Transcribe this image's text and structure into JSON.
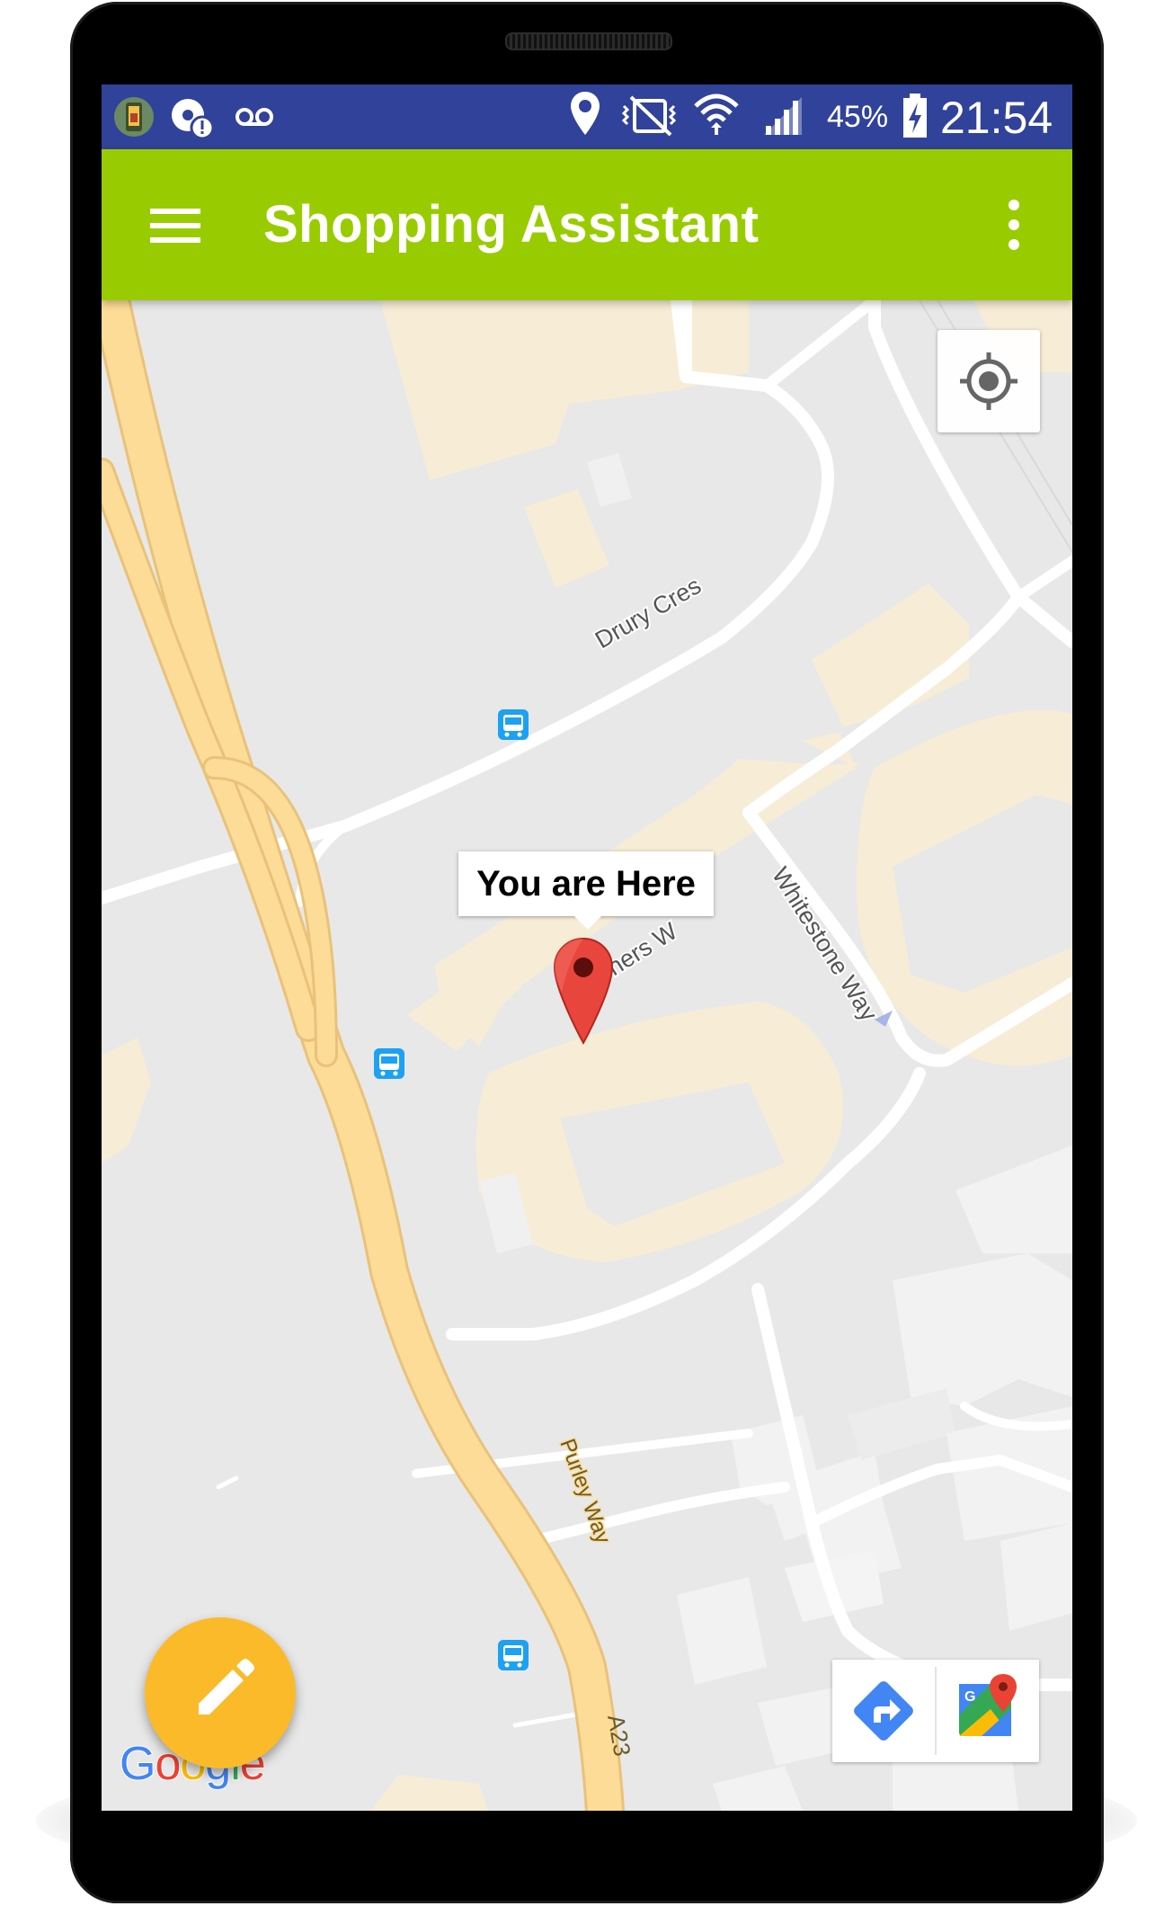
{
  "statusbar": {
    "battery_percent": "45%",
    "time": "21:54"
  },
  "appbar": {
    "title": "Shopping Assistant"
  },
  "map": {
    "streets": {
      "drury": "Drury Cres",
      "whitestone": "Whitestone Way",
      "purley": "Purley Way",
      "a23": "A23",
      "partial": "ners W"
    },
    "infowindow_text": "You are Here",
    "attribution": "Google"
  },
  "colors": {
    "statusbar": "#31429a",
    "appbar": "#99cc00",
    "fab": "#fbba2a",
    "marker": "#e8453c",
    "map_bg": "#e8e8e8",
    "building": "#f7ecd6",
    "highway": "#fcdc96"
  },
  "icons": [
    "menu-icon",
    "overflow-icon",
    "my-location-icon",
    "map-marker-icon",
    "edit-icon",
    "directions-icon",
    "google-maps-icon",
    "bus-stop-icon"
  ]
}
